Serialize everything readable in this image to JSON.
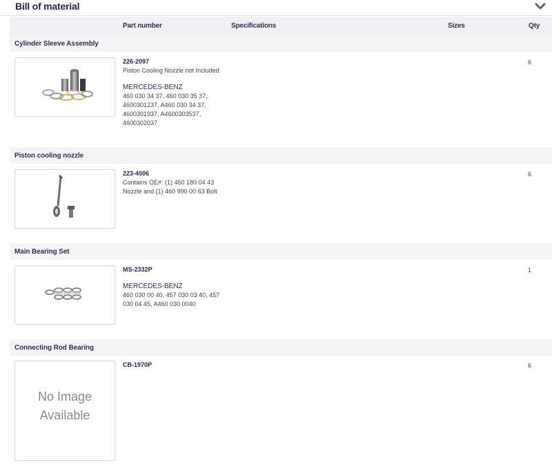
{
  "header": {
    "title": "Bill of material"
  },
  "columns": {
    "part_number": "Part number",
    "specifications": "Specifications",
    "sizes": "Sizes",
    "qty": "Qty"
  },
  "sections": [
    {
      "name": "Cylinder Sleeve Assembly",
      "part_number": "226-2097",
      "notes": [
        "Piston Cooling Nozzle not Included"
      ],
      "manufacturer": "MERCEDES-BENZ",
      "oe_numbers": [
        "460 030 34 37, 460 030 35 37,",
        "4600301237, A460 030 34 37,",
        "4600301937, A4600303537,",
        "4600302037"
      ],
      "qty": "6"
    },
    {
      "name": "Piston cooling nozzle",
      "part_number": "223-4006",
      "notes": [
        "Contains OE#: (1) 460 180 04 43",
        "Nozzle and (1) 460 990 00 63 Bolt"
      ],
      "qty": "6"
    },
    {
      "name": "Main Bearing Set",
      "part_number": "MS-2332P",
      "manufacturer": "MERCEDES-BENZ",
      "oe_numbers": [
        "460 030 00 40, 457 030 03 40, 457",
        "030 04 45, A460 030 0040"
      ],
      "qty": "1"
    },
    {
      "name": "Connecting Rod Bearing",
      "part_number": "CB-1970P",
      "no_image": [
        "No Image",
        "Available"
      ],
      "qty": "6"
    }
  ]
}
